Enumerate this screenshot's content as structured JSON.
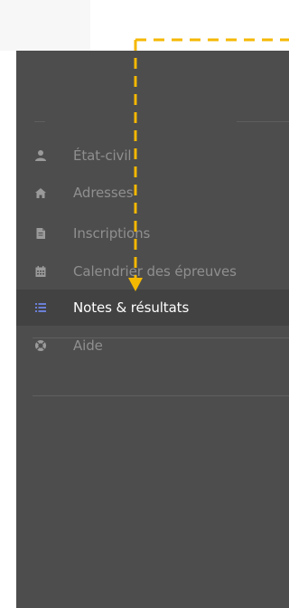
{
  "sidebar": {
    "items": [
      {
        "label": "État-civil",
        "icon": "user-icon"
      },
      {
        "label": "Adresses",
        "icon": "home-icon"
      },
      {
        "label": "Inscriptions",
        "icon": "document-icon"
      },
      {
        "label": "Calendrier des épreuves",
        "icon": "calendar-icon"
      },
      {
        "label": "Notes & résultats",
        "icon": "list-icon",
        "active": true
      }
    ],
    "help": {
      "label": "Aide",
      "icon": "lifebuoy-icon"
    }
  },
  "colors": {
    "sidebar_bg": "#4d4d4d",
    "active_bg": "#424242",
    "active_icon": "#6b7fd6",
    "inactive_text": "#8f8f8f",
    "annotation_arrow": "#f5b800"
  }
}
